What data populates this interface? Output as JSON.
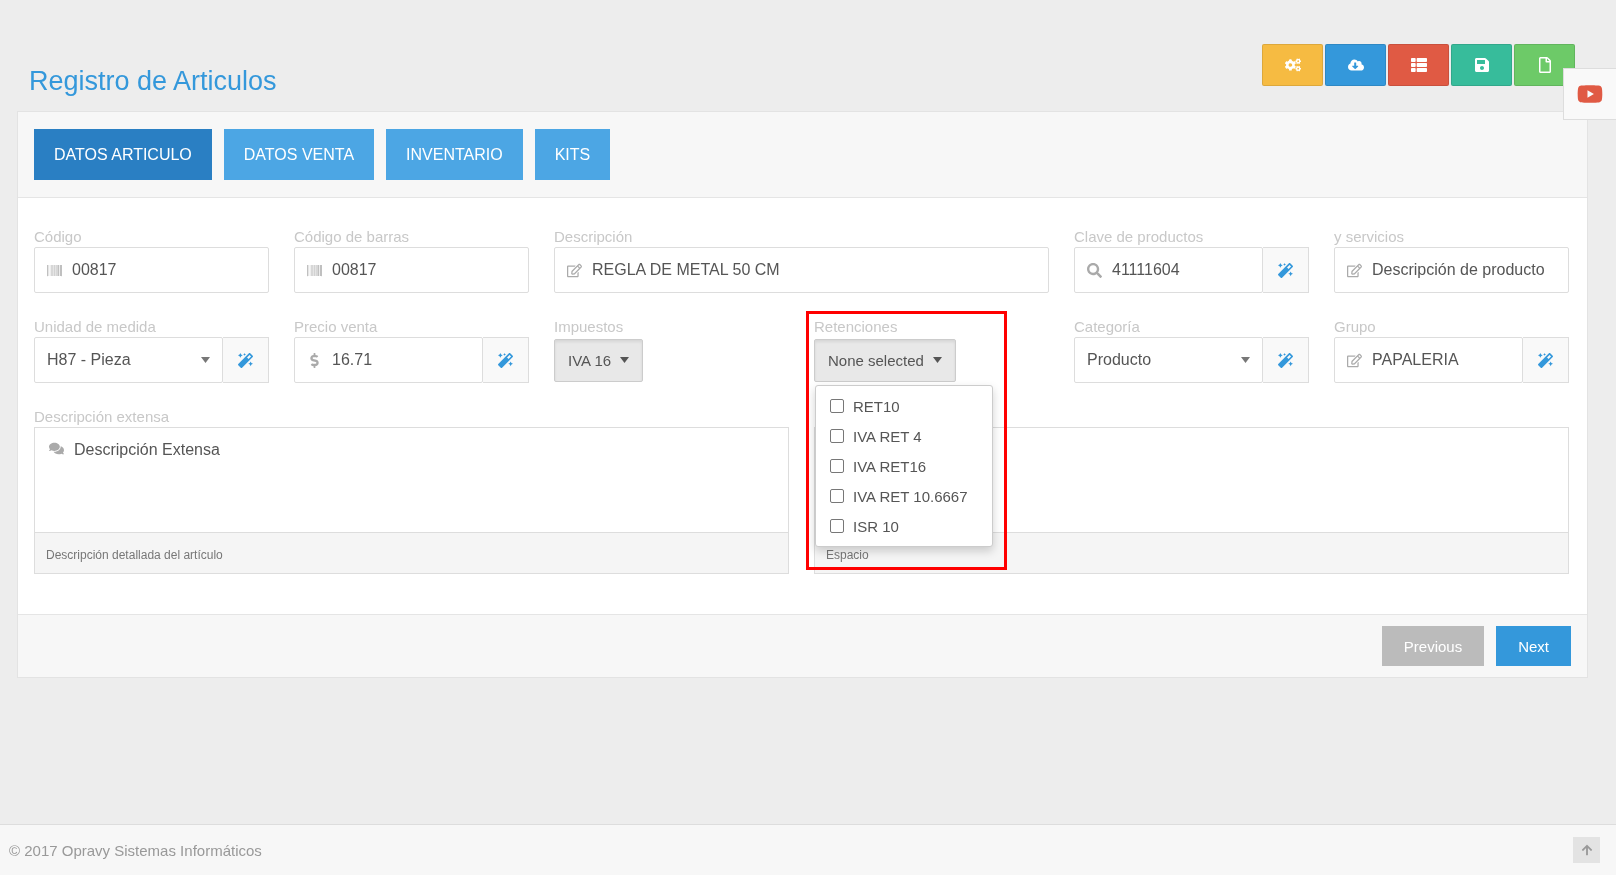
{
  "page_title": "Registro de Articulos",
  "toolbar": [
    {
      "color": "#f6bb42"
    },
    {
      "color": "#3498db"
    },
    {
      "color": "#e05a44"
    },
    {
      "color": "#37bc9b"
    },
    {
      "color": "#6dca68"
    }
  ],
  "tabs": [
    {
      "label": "DATOS ARTICULO",
      "selected": true
    },
    {
      "label": "DATOS VENTA",
      "selected": false
    },
    {
      "label": "INVENTARIO",
      "selected": false
    },
    {
      "label": "KITS",
      "selected": false
    }
  ],
  "fields": [
    {
      "kind": "input",
      "label": "Código",
      "value": "00817"
    },
    {
      "kind": "input",
      "label": "Código de barras",
      "value": "00817"
    },
    {
      "kind": "input",
      "label": "Descripción",
      "value": "REGLA DE METAL 50 CM"
    },
    {
      "kind": "input",
      "label": "Clave de productos",
      "value": "41111604",
      "addon": true
    },
    {
      "kind": "input",
      "label": "y servicios",
      "placeholder": "Descripción de producto"
    },
    {
      "kind": "select",
      "label": "Unidad de medida",
      "value": "H87 - Pieza",
      "addon": true
    },
    {
      "kind": "input",
      "label": "Precio venta",
      "value": "16.71",
      "addon": true
    },
    {
      "kind": "multiselect",
      "label": "Impuestos",
      "value": "IVA 16"
    },
    {
      "kind": "multiselect",
      "label": "Retenciones",
      "value": "None selected",
      "highlighted": true,
      "open": true,
      "options": [
        {
          "label": "RET10",
          "checked": false
        },
        {
          "label": "IVA RET 4",
          "checked": false
        },
        {
          "label": "IVA RET16",
          "checked": false
        },
        {
          "label": "IVA RET 10.6667",
          "checked": false
        },
        {
          "label": "ISR 10",
          "checked": false
        }
      ]
    },
    {
      "kind": "select",
      "label": "Categoría",
      "value": "Producto",
      "addon": true
    },
    {
      "kind": "input",
      "label": "Grupo",
      "value": "PAPALERIA",
      "addon": true
    },
    {
      "kind": "textarea",
      "label": "Descripción extensa",
      "placeholder": "Descripción Extensa",
      "help": "Descripción detallada del artículo"
    },
    {
      "kind": "textarea",
      "help": "Espacio"
    }
  ],
  "nav_buttons": [
    {
      "label": "Previous",
      "disabled": true
    },
    {
      "label": "Next",
      "disabled": false
    }
  ],
  "footer": "© 2017 Opravy Sistemas Informáticos"
}
